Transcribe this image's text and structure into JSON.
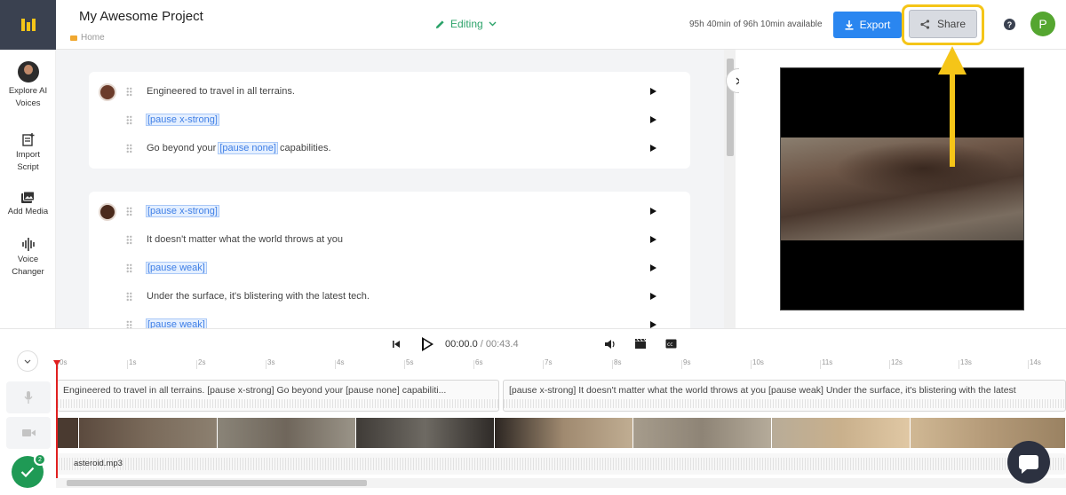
{
  "header": {
    "project_title": "My Awesome Project",
    "breadcrumb": "Home",
    "mode": "Editing",
    "availability": "95h 40min of 96h 10min available",
    "export_label": "Export",
    "share_label": "Share",
    "help_label": "?",
    "user_initial": "P"
  },
  "sidebar": {
    "items": [
      {
        "line1": "Explore AI",
        "line2": "Voices"
      },
      {
        "line1": "Import",
        "line2": "Script"
      },
      {
        "line1": "Add Media",
        "line2": ""
      },
      {
        "line1": "Voice",
        "line2": "Changer"
      }
    ]
  },
  "script": {
    "blocks": [
      {
        "lines": [
          {
            "pre": "Engineered to travel in all terrains.",
            "tag": "",
            "post": ""
          },
          {
            "pre": "",
            "tag": "[pause x-strong]",
            "post": ""
          },
          {
            "pre": "Go beyond your ",
            "tag": "[pause none]",
            "post": " capabilities."
          }
        ]
      },
      {
        "lines": [
          {
            "pre": "",
            "tag": "[pause x-strong]",
            "post": ""
          },
          {
            "pre": "It doesn't matter what the world throws at you",
            "tag": "",
            "post": ""
          },
          {
            "pre": "",
            "tag": "[pause weak]",
            "post": ""
          },
          {
            "pre": "Under the surface, it's blistering with the latest tech.",
            "tag": "",
            "post": ""
          },
          {
            "pre": "",
            "tag": "[pause weak]",
            "post": ""
          }
        ]
      }
    ]
  },
  "transport": {
    "current": "00:00.0",
    "separator": " / ",
    "duration": "00:43.4"
  },
  "timeline": {
    "ticks": [
      "0s",
      "1s",
      "2s",
      "3s",
      "4s",
      "5s",
      "6s",
      "7s",
      "8s",
      "9s",
      "10s",
      "11s",
      "12s",
      "13s",
      "14s"
    ],
    "voice_clips": [
      "Engineered to travel in all terrains. [pause x-strong] Go beyond your [pause none] capabiliti...",
      "[pause x-strong] It doesn't matter what the world throws at you [pause weak] Under the surface, it's blistering with the latest"
    ],
    "audio_file": "asteroid.mp3"
  },
  "notifications": {
    "badge_count": "2"
  },
  "colors": {
    "accent": "#2a86f0",
    "highlight": "#f5c518",
    "success": "#1f9a55"
  }
}
